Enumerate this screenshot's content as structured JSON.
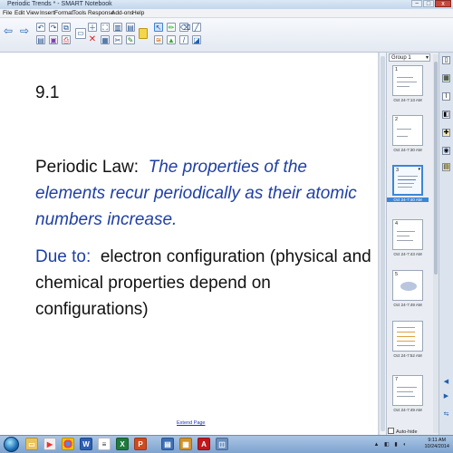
{
  "window": {
    "title": "Periodic Trends * - SMART Notebook"
  },
  "window_controls": {
    "minimize": "−",
    "maximize": "□",
    "close": "x"
  },
  "menu": [
    "File",
    "Edit",
    "View",
    "Insert",
    "Format",
    "Tools",
    "Response",
    "Add-ons",
    "Help"
  ],
  "toolbar": {
    "row1": [
      "back",
      "forward",
      "undo",
      "redo",
      "new-page",
      "delete-page",
      "screen-shade",
      "fullscreen",
      "select-tool",
      "pen-tool",
      "eraser-tool",
      "line-tool"
    ],
    "row2": [
      "open-file",
      "save-file",
      "paste",
      "cut",
      "print",
      "document-camera",
      "table",
      "creative-pen",
      "highlighter",
      "magic-pen"
    ]
  },
  "page": {
    "section_number": "9.1",
    "law_label": "Periodic Law:",
    "law_text_line1": "The properties of the",
    "law_text_line2": "elements recur periodically as their atomic",
    "law_text_line3": "numbers increase.",
    "due_label": "Due to:",
    "due_text_line1": "electron configuration (physical and",
    "due_text_line2": "chemical properties depend on",
    "due_text_line3": "configurations)",
    "extend_link": "Extend Page"
  },
  "sorter": {
    "group": "Group 1",
    "thumbnails": [
      {
        "number": "1",
        "time": "Oct 24-7:13 AM",
        "selected": false
      },
      {
        "number": "2",
        "time": "Oct 24-7:30 AM",
        "selected": false
      },
      {
        "number": "3",
        "time": "Oct 24-7:40 AM",
        "selected": true
      },
      {
        "number": "4",
        "time": "Oct 24-7:43 AM",
        "selected": false
      },
      {
        "number": "5",
        "time": "Oct 24-7:49 AM",
        "selected": false
      },
      {
        "number": "6",
        "time": "Oct 24-7:52 AM",
        "selected": false
      },
      {
        "number": "7",
        "time": "Oct 24-7:49 AM",
        "selected": false
      }
    ],
    "auto_hide_label": "Auto-hide"
  },
  "rightbar_icons": [
    "page-sorter-icon",
    "gallery-icon",
    "attachments-icon",
    "properties-icon",
    "add-ons-icon",
    "smart-response-icon",
    "expand-icon"
  ],
  "taskbar": {
    "apps": [
      "explorer",
      "media-player",
      "chrome",
      "word",
      "excel",
      "powerpoint",
      "acrobat",
      "smart-notebook",
      "notebook-tools"
    ],
    "clock_time": "9:11 AM",
    "clock_date": "10/24/2014"
  },
  "colors": {
    "accent_blue": "#1f3fa6",
    "selection": "#3b86d8",
    "taskbar": "#7ea3cf"
  }
}
